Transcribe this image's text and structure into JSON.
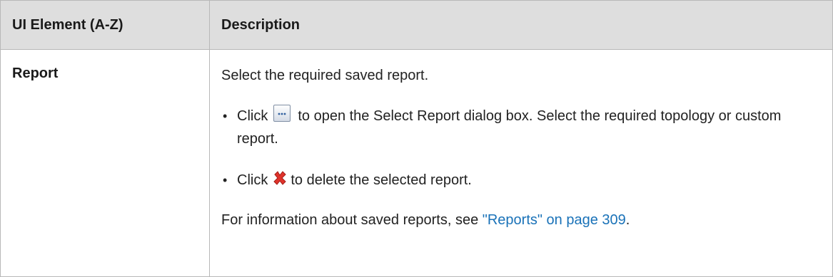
{
  "table": {
    "headers": {
      "element": "UI Element (A-Z)",
      "description": "Description"
    },
    "row": {
      "element": "Report",
      "intro": "Select the required saved report.",
      "bullets": [
        {
          "prefix": "Click",
          "icon": "browse-ellipsis-icon",
          "text": "to open the Select Report dialog box. Select the required topology or custom report."
        },
        {
          "prefix": "Click",
          "icon": "delete-x-icon",
          "text": "to delete the selected report."
        }
      ],
      "footer": {
        "prefix": "For information about saved reports, see ",
        "link_text": "\"Reports\" on page 309",
        "suffix": "."
      }
    }
  },
  "colors": {
    "header_bg": "#dedede",
    "border": "#b8b8b8",
    "link": "#1a72b8",
    "delete_icon": "#e0332b"
  }
}
